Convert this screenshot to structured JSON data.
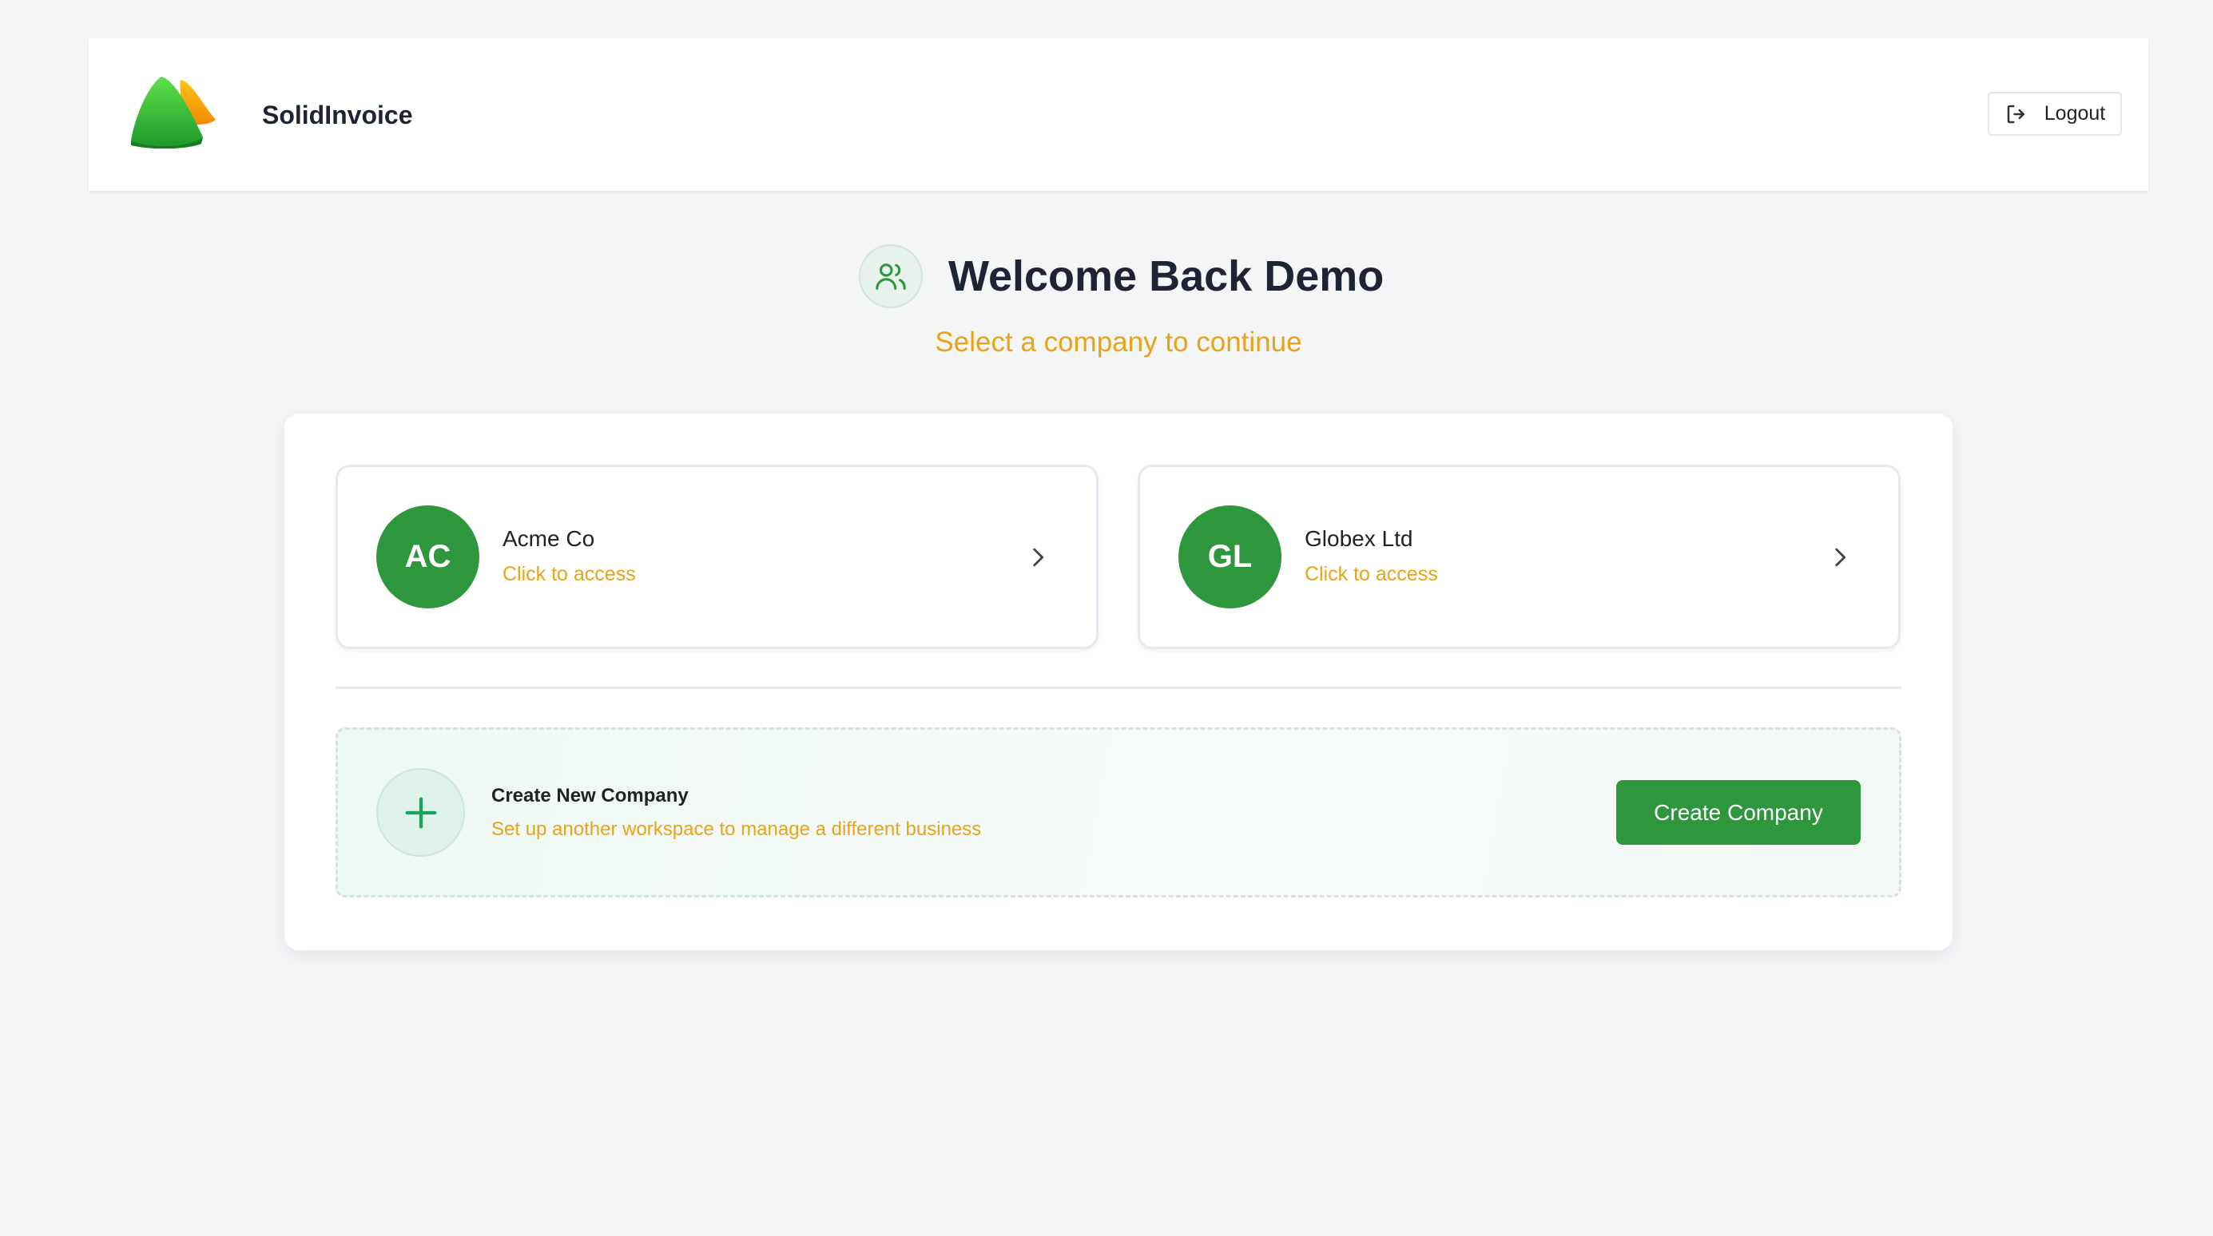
{
  "header": {
    "brand": "SolidInvoice",
    "logout_label": "Logout"
  },
  "welcome": {
    "title": "Welcome Back Demo",
    "subtitle": "Select a company to continue"
  },
  "companies": [
    {
      "initials": "AC",
      "name": "Acme Co",
      "action": "Click to access"
    },
    {
      "initials": "GL",
      "name": "Globex Ltd",
      "action": "Click to access"
    }
  ],
  "create": {
    "title": "Create New Company",
    "description": "Set up another workspace to manage a different business",
    "button_label": "Create Company"
  },
  "icons": {
    "logout": "logout-icon",
    "welcome": "users-icon",
    "chevron": "chevron-right-icon",
    "plus": "plus-icon",
    "logo": "solidinvoice-logo"
  },
  "colors": {
    "accent_green": "#2e963d",
    "subtext_orange": "#e8a317",
    "background": "#f4f5f7"
  }
}
